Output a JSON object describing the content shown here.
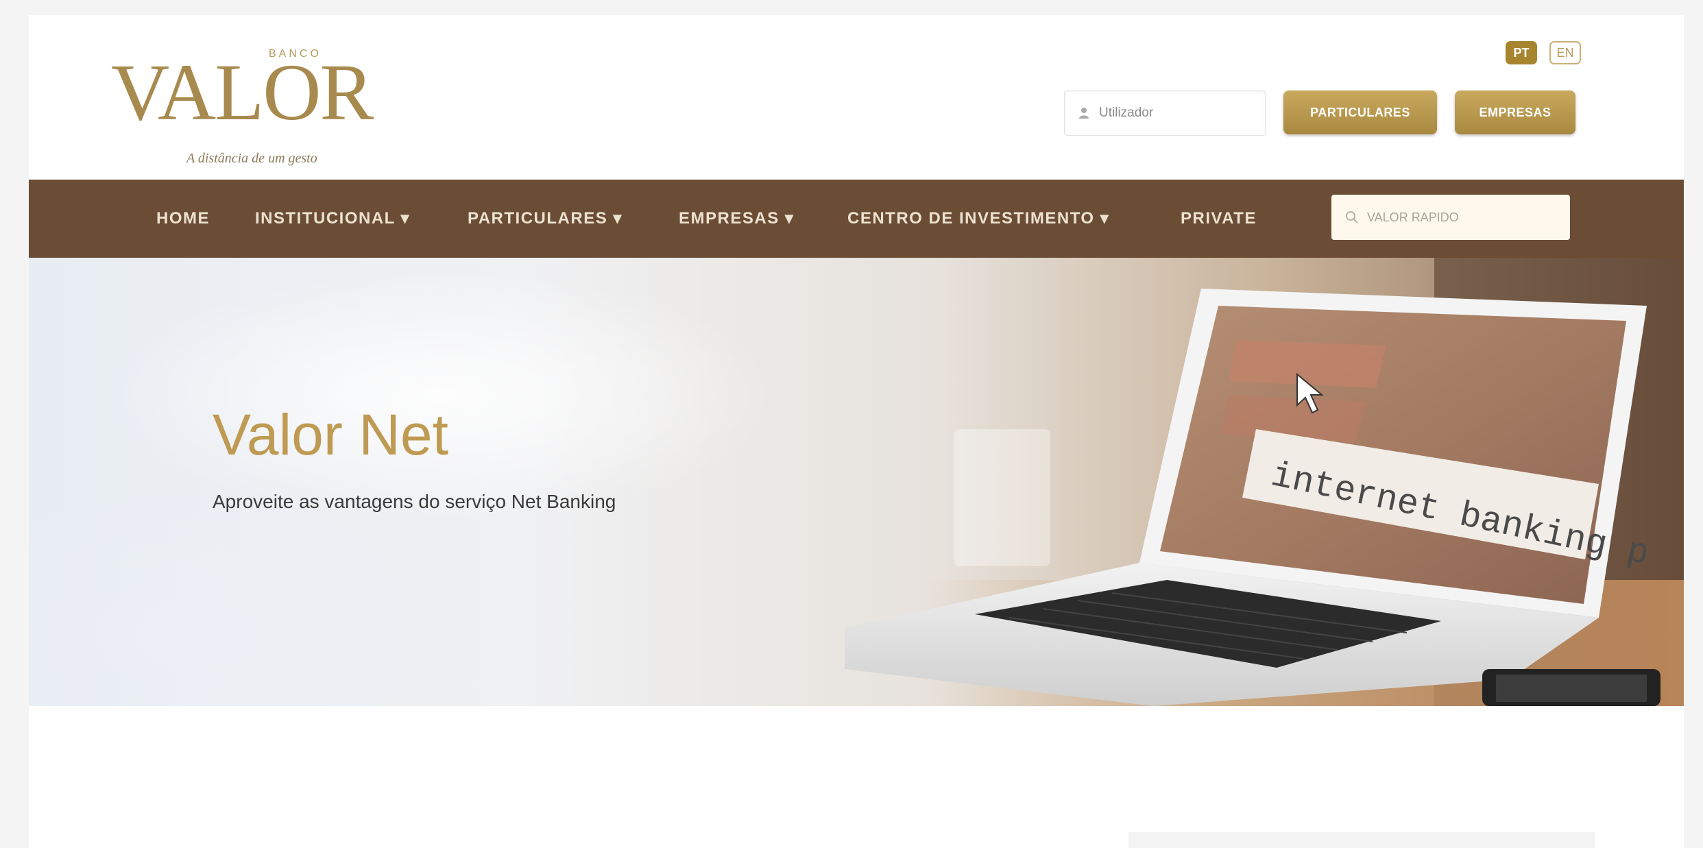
{
  "brand": {
    "banco_label": "BANCO",
    "name": "VALOR",
    "tagline": "A distância de um gesto"
  },
  "languages": {
    "active": "PT",
    "other": "EN"
  },
  "login": {
    "user_placeholder": "Utilizador",
    "particulares_label": "PARTICULARES",
    "empresas_label": "EMPRESAS"
  },
  "nav": {
    "items": [
      {
        "label": "HOME"
      },
      {
        "label": "INSTITUCIONAL ▾"
      },
      {
        "label": "PARTICULARES ▾"
      },
      {
        "label": "EMPRESAS ▾"
      },
      {
        "label": "CENTRO DE INVESTIMENTO ▾"
      },
      {
        "label": "PRIVATE"
      }
    ],
    "search_placeholder": "VALOR RAPIDO"
  },
  "hero": {
    "title": "Valor Net",
    "subtitle": "Aproveite as vantagens do serviço Net Banking",
    "screen_text": "internet banking p"
  },
  "colors": {
    "gold": "#bf9a52",
    "nav_brown": "#6b4c34",
    "button_gold": "#a9893f"
  }
}
